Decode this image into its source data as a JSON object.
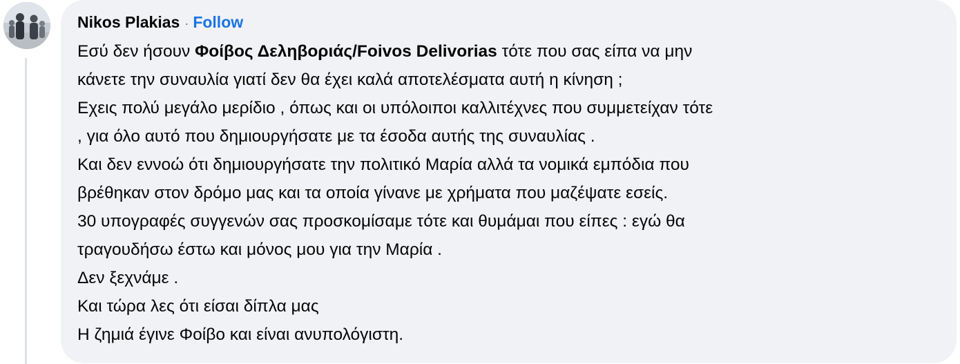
{
  "comment": {
    "author": "Nikos Plakias",
    "separator": "·",
    "follow_label": "Follow",
    "line_1_before_mention": "Εσύ δεν ήσουν ",
    "mention": "Φοίβος Δεληβοριάς/Foivos Delivorias",
    "line_1_after_mention": " τότε που σας είπα να μην",
    "lines": [
      "κάνετε την συναυλία γιατί δεν θα έχει καλά αποτελέσματα αυτή η κίνηση ;",
      "Εχεις πολύ μεγάλο μερίδιο , όπως και οι υπόλοιποι καλλιτέχνες που συμμετείχαν τότε",
      ", για όλο αυτό που δημιουργήσατε με τα έσοδα αυτής της συναυλίας .",
      "Και δεν εννοώ ότι δημιουργήσατε την πολιτικό Μαρία αλλά τα νομικά εμπόδια που",
      "βρέθηκαν στον δρόμο μας και τα οποία γίνανε με χρήματα που μαζέψατε εσείς.",
      "30 υπογραφές συγγενών σας προσκομίσαμε τότε και θυμάμαι που είπες : εγώ θα",
      "τραγουδήσω έστω και μόνος μου για την Μαρία .",
      "Δεν ξεχνάμε .",
      "Και τώρα λες ότι είσαι δίπλα μας",
      "Η ζημιά έγινε Φοίβο και είναι ανυπολόγιστη."
    ]
  },
  "colors": {
    "bubble_background": "#f0f2f5",
    "text": "#050505",
    "follow_link": "#1b74e4",
    "thread_line": "#dde1e6"
  },
  "icons": {
    "avatar": "profile-photo-avatar"
  }
}
